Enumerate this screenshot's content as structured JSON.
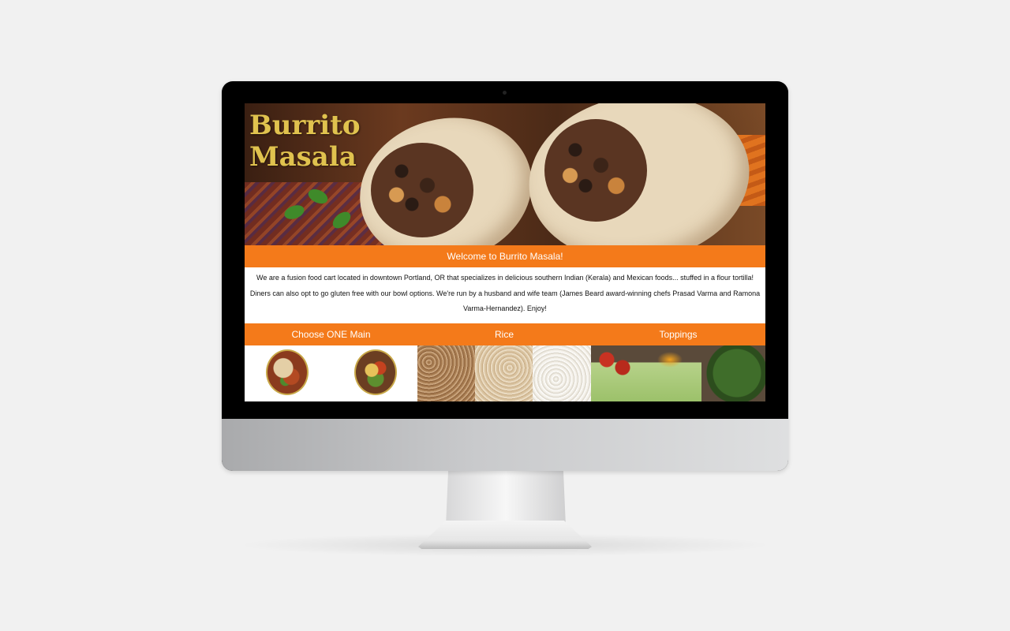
{
  "site": {
    "logo_line1": "Burrito",
    "logo_line2": "Masala",
    "welcome": "Welcome to Burrito Masala!",
    "intro": "We are a fusion food cart located in downtown Portland, OR that specializes in delicious southern Indian (Kerala) and Mexican foods... stuffed in a flour tortilla! Diners can also opt to go gluten free with our bowl options. We're run by a husband and wife team (James Beard award-winning chefs Prasad Varma and Ramona Varma-Hernandez). Enjoy!"
  },
  "sections": {
    "main": "Choose ONE Main",
    "rice": "Rice",
    "toppings": "Toppings"
  },
  "icons": {
    "camera": "camera-dot-icon"
  },
  "colors": {
    "accent": "#f47a1a",
    "logo": "#e0c24e"
  }
}
